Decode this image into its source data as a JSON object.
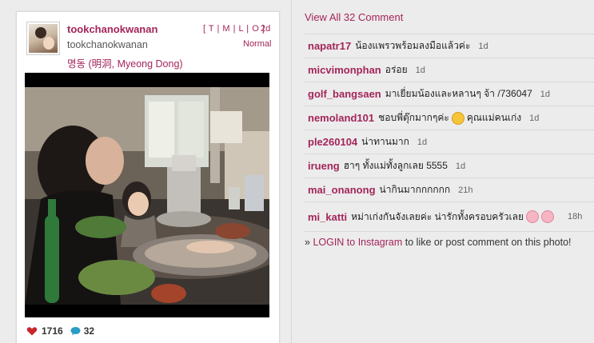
{
  "post": {
    "username": "tookchanokwanan",
    "full_name": "tookchanokwanan",
    "location": "명동 (明洞, Myeong Dong)",
    "sizes": "[ T | M | L | O ]",
    "age": "2d",
    "filter": "Normal",
    "likes": "1716",
    "comment_count": "32"
  },
  "comments_header": {
    "view_all": "View All 32 Comment"
  },
  "comments": [
    {
      "user": "napatr17",
      "text": "น้องแพรวพร้อมลงมือแล้วค่ะ",
      "time": "1d"
    },
    {
      "user": "micvimonphan",
      "text": "อร่อย",
      "time": "1d"
    },
    {
      "user": "golf_bangsaen",
      "text": "มาเยี่ยมน้องและหลานๆ จ้า /736047",
      "time": "1d"
    },
    {
      "user": "nemoland101",
      "text_before": "ชอบพี่ตุ๊กมากๆค่ะ",
      "text_after": "คุณแม่คนเก่ง",
      "time": "1d"
    },
    {
      "user": "ple260104",
      "text": "น่าทานมาก",
      "time": "1d"
    },
    {
      "user": "irueng",
      "text": "ฮาๆ ทั้งแม่ทั้งลูกเลย 5555",
      "time": "1d"
    },
    {
      "user": "mai_onanong",
      "text": "น่ากินมากกกกกก",
      "time": "21h"
    },
    {
      "user": "mi_katti",
      "text": "หม่าเก่งกันจังเลยค่ะ น่ารักทั้งครอบครัวเลย",
      "time": "18h"
    }
  ],
  "login": {
    "prefix": "»",
    "link": "LOGIN to Instagram",
    "suffix": "to like or post comment on this photo!"
  },
  "colors": {
    "accent": "#a3255a",
    "background": "#ececec"
  }
}
